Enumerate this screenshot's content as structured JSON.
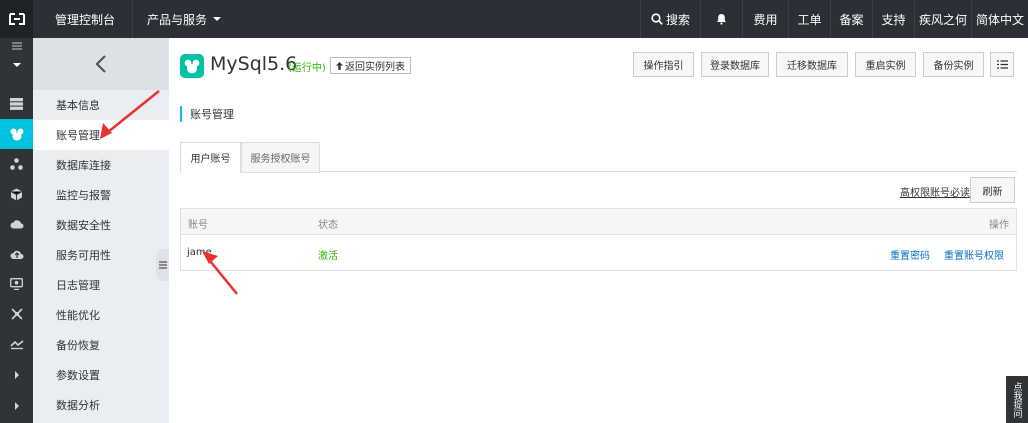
{
  "topbar": {
    "console_label": "管理控制台",
    "products_label": "产品与服务",
    "search_label": "搜索",
    "fees_label": "费用",
    "tickets_label": "工单",
    "record_label": "备案",
    "support_label": "支持",
    "user_label": "疾风之何",
    "lang_label": "简体中文"
  },
  "subnav": {
    "items": [
      {
        "label": "基本信息"
      },
      {
        "label": "账号管理"
      },
      {
        "label": "数据库连接"
      },
      {
        "label": "监控与报警"
      },
      {
        "label": "数据安全性"
      },
      {
        "label": "服务可用性"
      },
      {
        "label": "日志管理"
      },
      {
        "label": "性能优化"
      },
      {
        "label": "备份恢复"
      },
      {
        "label": "参数设置"
      },
      {
        "label": "数据分析"
      }
    ]
  },
  "header": {
    "title": "MySql5.6",
    "status": "(运行中)",
    "back_list": "返回实例列表",
    "buttons": {
      "guide": "操作指引",
      "login_db": "登录数据库",
      "migrate": "迁移数据库",
      "restart": "重启实例",
      "backup": "备份实例"
    }
  },
  "section_title": "账号管理",
  "tabs": {
    "user_account": "用户账号",
    "service_account": "服务授权账号"
  },
  "required_link": "高权限账号必读",
  "refresh_label": "刷新",
  "table": {
    "headers": {
      "account": "账号",
      "status": "状态",
      "action": "操作"
    },
    "rows": [
      {
        "account": "jame",
        "status": "激活",
        "reset_pwd": "重置密码",
        "reset_perm": "重置账号权限"
      }
    ]
  },
  "side_tab": "点我提问",
  "colors": {
    "accent": "#00c1de",
    "topbar": "#2a3036",
    "status_green": "#2db500",
    "link": "#0570c6",
    "annotation": "#e8312f"
  }
}
